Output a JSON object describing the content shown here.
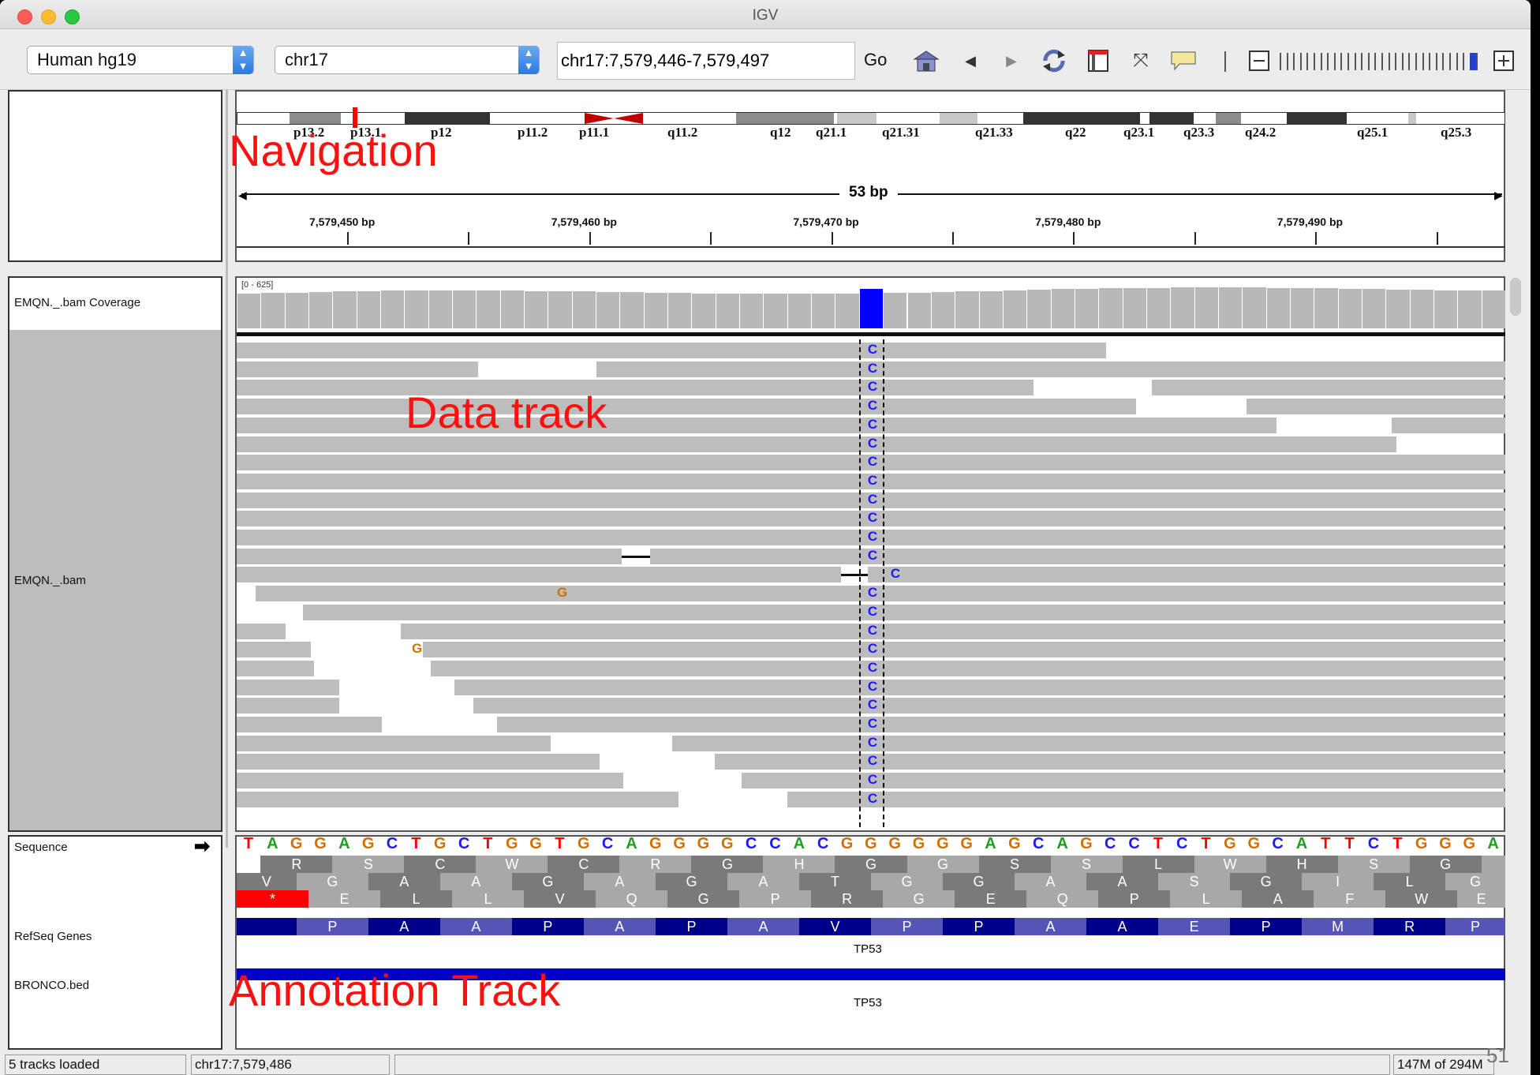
{
  "window": {
    "title": "IGV"
  },
  "toolbar": {
    "genome": "Human hg19",
    "chromosome": "chr17",
    "locus": "chr17:7,579,446-7,579,497",
    "go_label": "Go",
    "zoom_level_fraction": 0.95
  },
  "navigation": {
    "bands": [
      "p13.2",
      "p13.1",
      "p12",
      "p11.2",
      "p11.1",
      "q11.2",
      "q12",
      "q21.1",
      "q21.31",
      "q21.33",
      "q22",
      "q23.1",
      "q23.3",
      "q24.2",
      "q25.1",
      "q25.3"
    ],
    "span_label": "53 bp",
    "ticks": [
      "7,579,450 bp",
      "7,579,460 bp",
      "7,579,470 bp",
      "7,579,480 bp",
      "7,579,490 bp"
    ]
  },
  "tracks": {
    "coverage_label": "EMQN._.bam Coverage",
    "coverage_range": "[0 - 625]",
    "bam_label": "EMQN._.bam",
    "sequence_label": "Sequence",
    "refseq_label": "RefSeq Genes",
    "bed_label": "BRONCO.bed",
    "gene_name": "TP53",
    "bed_feature_name": "TP53"
  },
  "reads": {
    "variant_base": "C",
    "mismatch_base": "G"
  },
  "sequence": "TAGGAGCTGCTGGTGCAGGGGCCACGGGGGGAGCAGCCTCTGGCATTCTGGGA",
  "translation": {
    "frame1": [
      "V",
      "G",
      "A",
      "A",
      "G",
      "A",
      "G",
      "A",
      "T",
      "G",
      "G",
      "A",
      "A",
      "S",
      "G",
      "I",
      "L",
      "G"
    ],
    "frame2": [
      "R",
      "S",
      "C",
      "W",
      "C",
      "R",
      "G",
      "H",
      "G",
      "G",
      "S",
      "S",
      "L",
      "W",
      "H",
      "S",
      "G"
    ],
    "frame3": [
      "*",
      "E",
      "L",
      "L",
      "V",
      "Q",
      "G",
      "P",
      "R",
      "G",
      "E",
      "Q",
      "P",
      "L",
      "A",
      "F",
      "W",
      "E"
    ]
  },
  "gene_aa": [
    "P",
    "A",
    "A",
    "P",
    "A",
    "P",
    "A",
    "V",
    "P",
    "P",
    "A",
    "A",
    "E",
    "P",
    "M",
    "R",
    "P"
  ],
  "annotations": {
    "navigation": "Navigation",
    "data_track": "Data track",
    "annotation_track": "Annotation Track"
  },
  "status": {
    "tracks_loaded": "5 tracks loaded",
    "position": "chr17:7,579,486",
    "memory": "147M of 294M"
  },
  "slide_number": "51",
  "colors": {
    "A": "#20a020",
    "C": "#1a1aff",
    "G": "#d07000",
    "T": "#ff0000",
    "variant": "#1a1aff",
    "gene": "#00008b",
    "bed": "#0000c8"
  }
}
